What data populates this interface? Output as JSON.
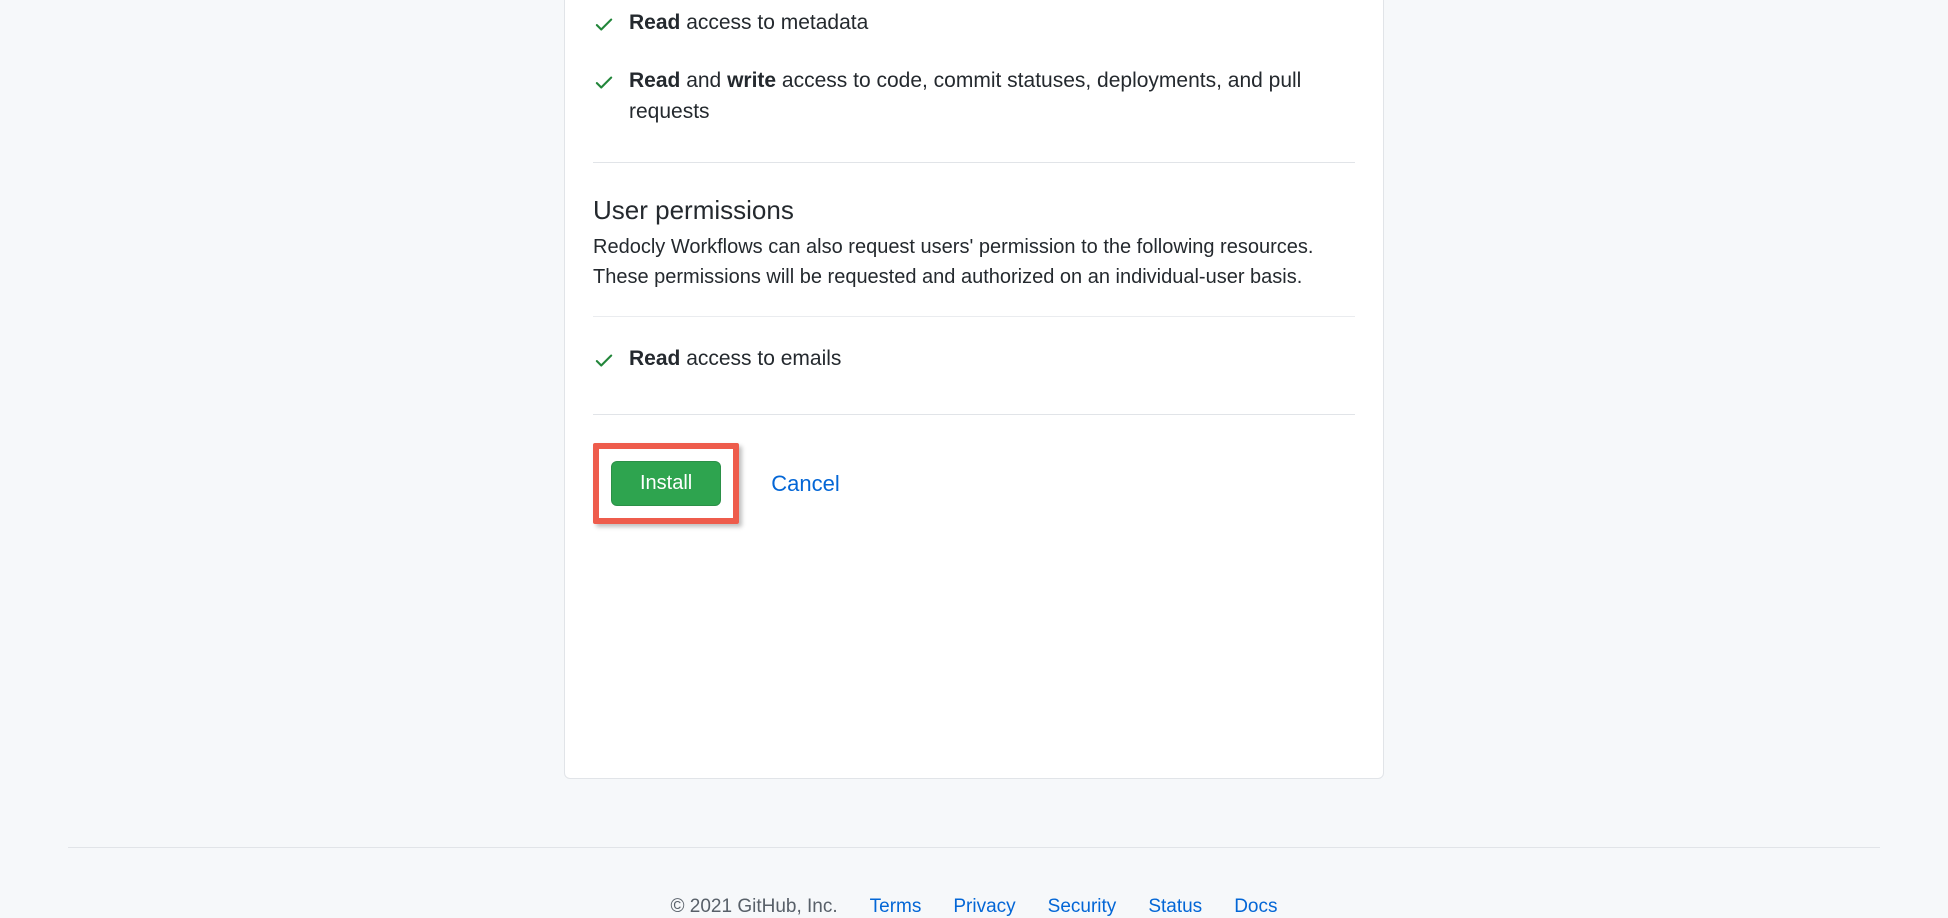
{
  "repo_permissions": [
    {
      "parts": [
        {
          "text": "Read",
          "bold": true
        },
        {
          "text": " access to metadata",
          "bold": false
        }
      ]
    },
    {
      "parts": [
        {
          "text": "Read",
          "bold": true
        },
        {
          "text": " and ",
          "bold": false
        },
        {
          "text": "write",
          "bold": true
        },
        {
          "text": " access to code, commit statuses, deployments, and pull requests",
          "bold": false
        }
      ]
    }
  ],
  "user_permissions_section": {
    "title": "User permissions",
    "description": "Redocly Workflows can also request users' permission to the following resources. These permissions will be requested and authorized on an individual-user basis."
  },
  "user_permissions": [
    {
      "parts": [
        {
          "text": "Read",
          "bold": true
        },
        {
          "text": " access to emails",
          "bold": false
        }
      ]
    }
  ],
  "actions": {
    "install_label": "Install",
    "cancel_label": "Cancel"
  },
  "footer": {
    "copyright": "© 2021 GitHub, Inc.",
    "links": [
      "Terms",
      "Privacy",
      "Security",
      "Status",
      "Docs"
    ]
  }
}
